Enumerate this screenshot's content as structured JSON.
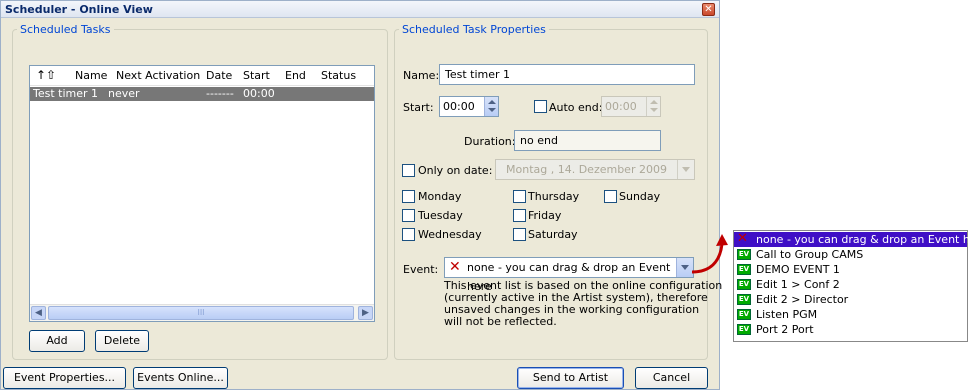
{
  "window": {
    "title": "Scheduler - Online View",
    "close_glyph": "✕"
  },
  "scheduled_tasks": {
    "legend": "Scheduled Tasks",
    "columns": [
      "Name",
      "Next Activation",
      "Date",
      "Start",
      "End",
      "Status"
    ],
    "rows": [
      {
        "name": "Test timer 1",
        "next_activation": "never",
        "date": "-------",
        "start": "00:00",
        "end": "",
        "status": ""
      }
    ],
    "scroll_thumb_grip": "III",
    "add_label": "Add",
    "delete_label": "Delete"
  },
  "properties": {
    "legend": "Scheduled Task Properties",
    "name_label": "Name:",
    "name_value": "Test timer 1",
    "start_label": "Start:",
    "start_value": "00:00",
    "auto_end_label": "Auto end:",
    "auto_end_value": "00:00",
    "duration_label": "Duration:",
    "duration_value": "no end",
    "only_on_date_label": "Only on date:",
    "date_value": "Montag   , 14. Dezember 2009",
    "days": {
      "monday": "Monday",
      "tuesday": "Tuesday",
      "wednesday": "Wednesday",
      "thursday": "Thursday",
      "friday": "Friday",
      "saturday": "Saturday",
      "sunday": "Sunday"
    },
    "event_label": "Event:",
    "event_value": "none - you can drag & drop an Event here",
    "note_lines": [
      "This event list is based on the online configuration",
      "(currently active in the Artist system), therefore",
      "unsaved changes in the working configuration",
      "will not be reflected."
    ]
  },
  "footer": {
    "event_properties_label": "Event Properties...",
    "events_online_label": "Events Online...",
    "send_label": "Send to Artist",
    "cancel_label": "Cancel"
  },
  "event_popup": {
    "ev_tag": "EV",
    "items": [
      {
        "label": "none - you can drag & drop an Event here",
        "icon": "red-x-icon"
      },
      {
        "label": "Call to Group CAMS",
        "icon": "ev-icon"
      },
      {
        "label": "DEMO EVENT 1",
        "icon": "ev-icon"
      },
      {
        "label": "Edit 1 > Conf 2",
        "icon": "ev-icon"
      },
      {
        "label": "Edit 2 > Director",
        "icon": "ev-icon"
      },
      {
        "label": "Listen PGM",
        "icon": "ev-icon"
      },
      {
        "label": "Port 2 Port",
        "icon": "ev-icon"
      }
    ]
  },
  "colors": {
    "accent": "#0046d5",
    "selection": "#3f0fc6",
    "arrow": "#c00000"
  }
}
